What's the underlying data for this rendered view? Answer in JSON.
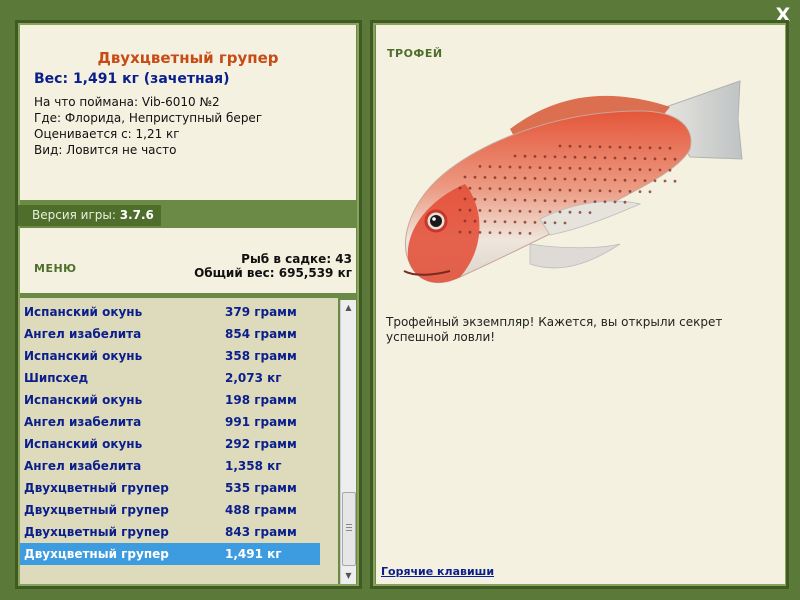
{
  "close_label": "X",
  "fish_card": {
    "name": "Двухцветный групер",
    "weight": "Вес: 1,491 кг (зачетная)",
    "bait": "На что поймана: Vib-6010 №2",
    "location": "Где: Флорида, Неприступный берег",
    "rated_from": "Оценивается с: 1,21 кг",
    "kind": "Вид: Ловится не часто"
  },
  "version": {
    "label": "Версия игры:",
    "value": "3.7.6"
  },
  "menu_label": "МЕНЮ",
  "stats": {
    "fish_in_keepnet": "Рыб в садке: 43",
    "total_weight": "Общий вес: 695,539 кг"
  },
  "catch_list": [
    {
      "name": "Испанский окунь",
      "weight": "379 грамм"
    },
    {
      "name": "Ангел изабелита",
      "weight": "854 грамм"
    },
    {
      "name": "Испанский окунь",
      "weight": "358 грамм"
    },
    {
      "name": "Шипсхед",
      "weight": "2,073 кг"
    },
    {
      "name": "Испанский окунь",
      "weight": "198 грамм"
    },
    {
      "name": "Ангел изабелита",
      "weight": "991 грамм"
    },
    {
      "name": "Испанский окунь",
      "weight": "292 грамм"
    },
    {
      "name": "Ангел изабелита",
      "weight": "1,358 кг"
    },
    {
      "name": "Двухцветный групер",
      "weight": "535 грамм"
    },
    {
      "name": "Двухцветный групер",
      "weight": "488 грамм"
    },
    {
      "name": "Двухцветный групер",
      "weight": "843 грамм"
    },
    {
      "name": "Двухцветный групер",
      "weight": "1,491 кг",
      "selected": true
    }
  ],
  "trophy_label": "ТРОФЕЙ",
  "description": "Трофейный экземпляр! Кажется, вы открыли секрет успешной ловли!",
  "hotkeys_label": "Горячие клавиши",
  "colors": {
    "background": "#5b7a3a",
    "panel": "#f4f1e0",
    "list_bg": "#dedabc",
    "accent_orange": "#c84a14",
    "text_blue": "#0a1f8c",
    "selected": "#3d9be0"
  },
  "icons": [
    "close-icon",
    "scroll-up-icon",
    "scroll-down-icon"
  ]
}
